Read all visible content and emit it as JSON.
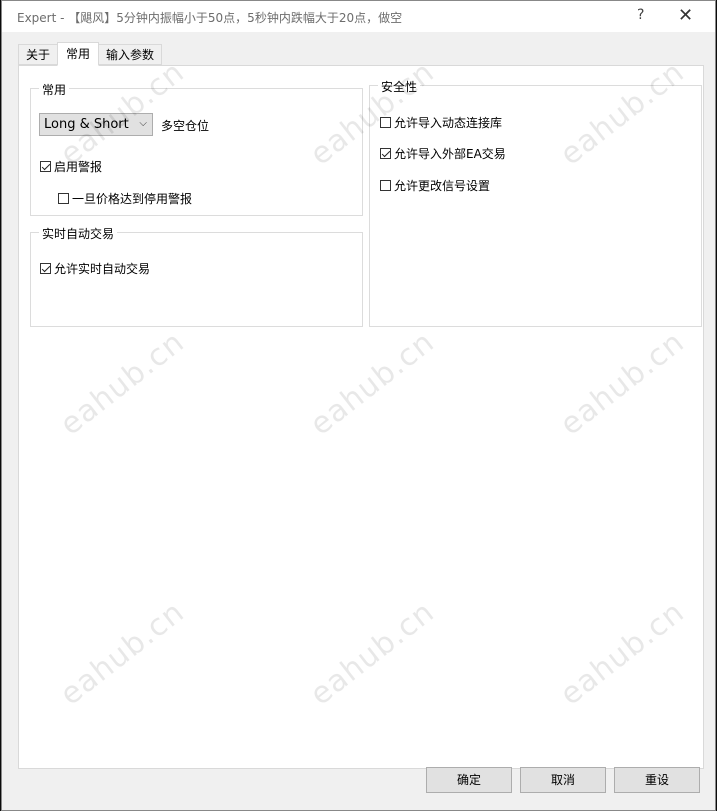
{
  "window": {
    "title": "Expert - 【飓风】5分钟内振幅小于50点，5秒钟内跌幅大于20点，做空",
    "help_glyph": "?",
    "close_glyph": "✕"
  },
  "tabs": [
    {
      "label": "关于",
      "active": false
    },
    {
      "label": "常用",
      "active": true
    },
    {
      "label": "输入参数",
      "active": false
    }
  ],
  "common_group": {
    "title": "常用",
    "position_select": {
      "value": "Long & Short",
      "label": "多空仓位"
    },
    "enable_alert": {
      "label": "启用警报",
      "checked": true
    },
    "disable_alert_on_price": {
      "label": "一旦价格达到停用警报",
      "checked": false
    }
  },
  "live_trading_group": {
    "title": "实时自动交易",
    "allow_live_trading": {
      "label": "允许实时自动交易",
      "checked": true
    }
  },
  "security_group": {
    "title": "安全性",
    "allow_dll": {
      "label": "允许导入动态连接库",
      "checked": false
    },
    "allow_external_ea": {
      "label": "允许导入外部EA交易",
      "checked": true
    },
    "allow_signal_change": {
      "label": "允许更改信号设置",
      "checked": false
    }
  },
  "buttons": {
    "ok": "确定",
    "cancel": "取消",
    "reset": "重设"
  },
  "watermark_text": "eahub.cn"
}
